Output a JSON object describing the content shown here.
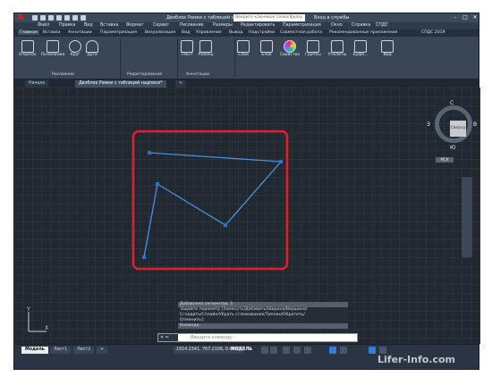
{
  "app": {
    "logo": "A",
    "title": "Двоблок Рамки с таблицей надписи",
    "search_placeholder": "Введите ключевое слово/фразу",
    "signin": "Вход в службы",
    "win_buttons": [
      "–",
      "□",
      "✕"
    ]
  },
  "menu": [
    "Файл",
    "Правка",
    "Вид",
    "Вставка",
    "Формат",
    "Сервис",
    "Рисование",
    "Размеры",
    "Редактировать",
    "Параметризация",
    "Окно",
    "Справка",
    "СПДС"
  ],
  "ribbon_tabs": [
    "Главная",
    "Вставка",
    "Аннотации",
    "Параметризация",
    "Визуализация",
    "Вид",
    "Управление",
    "Вывод",
    "Надстройки",
    "Совместная работа",
    "Рекомендованные приложения",
    "СПДС 2019"
  ],
  "ribbon_tools": [
    "Отрезок",
    "Полилиния",
    "Круг",
    "Дуга",
    "Текст",
    "Размер",
    "Слои",
    "Блок",
    "Свойства",
    "Группы",
    "Утилиты",
    "Буфе...",
    "Вид"
  ],
  "panels": [
    "Рисование",
    "Редактирование",
    "Аннотации"
  ],
  "doc_tabs": [
    "Начало",
    "Двоблок Рамки с таблицей надписи*",
    "+"
  ],
  "viewcube": {
    "top": "Сверху",
    "n": "С",
    "s": "Ю",
    "w": "З",
    "e": "В",
    "wcs": "МСК"
  },
  "command": {
    "history": [
      "Добавлено сегментов: 3",
      "Задайте параметр [Замкнуть/Добавить/Ширина/Вершина/",
      "Сгладить/Сплайн/Убрать сглаживание/Типлин/Обратить/",
      "Отменить]:",
      "Команда:"
    ],
    "placeholder": "Введите команду",
    "x_label": "✕ ✏"
  },
  "layout_tabs": [
    "Модель",
    "Лист1",
    "Лист2",
    "+"
  ],
  "status": {
    "coords": "1914.2341, 767.2106, 0.0000",
    "model": "МОДЕЛЬ"
  },
  "colors": {
    "highlight": "#e0202b",
    "polyline": "#4a90e2"
  },
  "watermark": "Lifer-Info.com"
}
